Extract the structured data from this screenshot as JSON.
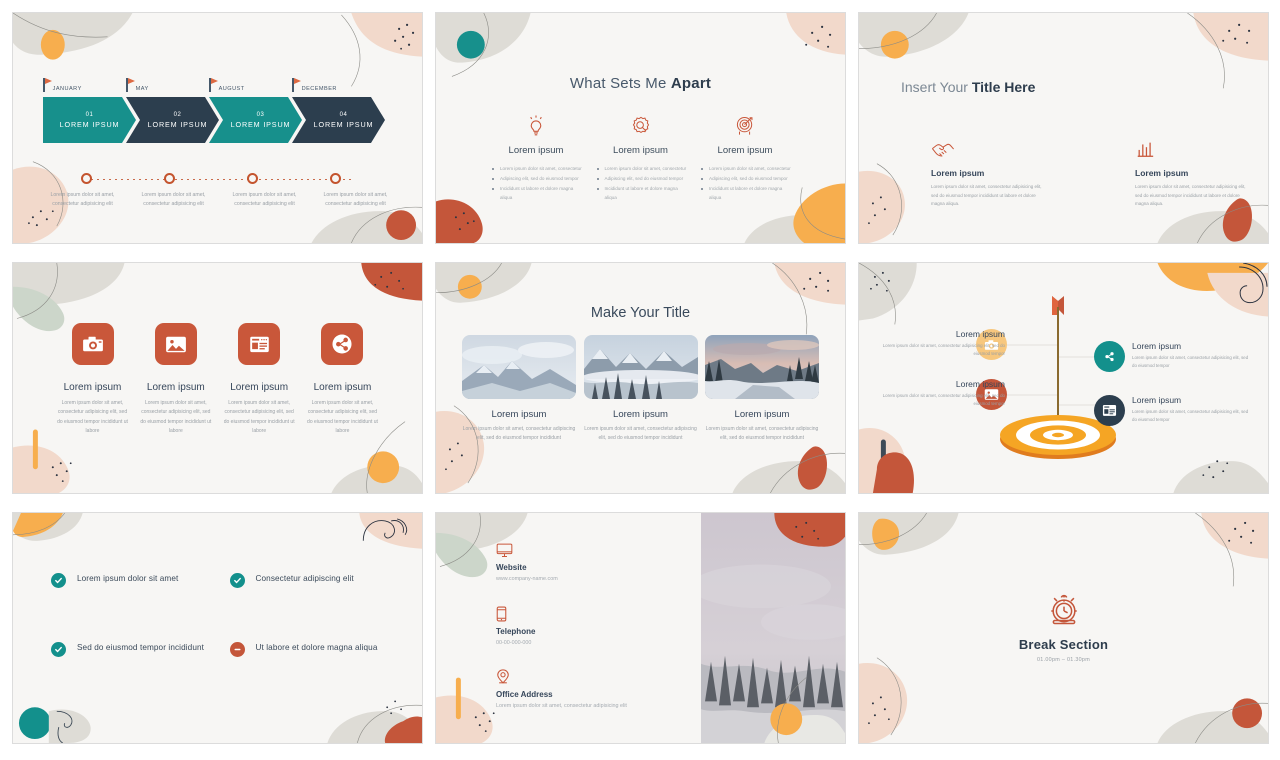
{
  "theme": {
    "teal": "#17908c",
    "navy": "#2c3e4e",
    "terracotta": "#c9573a",
    "orange": "#f5a93f",
    "blush": "#f2d9cb",
    "grey": "#dcdcd6",
    "slide_bg": "#f7f6f4"
  },
  "slides": [
    {
      "id": "timeline",
      "flags": [
        "JANUARY",
        "MAY",
        "AUGUST",
        "DECEMBER"
      ],
      "steps": [
        {
          "num": "01",
          "label": "LOREM IPSUM",
          "color": "teal"
        },
        {
          "num": "02",
          "label": "LOREM IPSUM",
          "color": "navy"
        },
        {
          "num": "03",
          "label": "LOREM IPSUM",
          "color": "teal"
        },
        {
          "num": "04",
          "label": "LOREM IPSUM",
          "color": "navy"
        }
      ],
      "captions": [
        "Lorem ipsum dolor sit amet, consectetur adipisicing elit",
        "Lorem ipsum dolor sit amet, consectetur adipisicing elit",
        "Lorem ipsum dolor sit amet, consectetur adipisicing elit",
        "Lorem ipsum dolor sit amet, consectetur adipisicing elit"
      ]
    },
    {
      "id": "what-sets-me-apart",
      "title_light": "What Sets Me ",
      "title_bold": "Apart",
      "columns": [
        {
          "icon": "lightbulb-icon",
          "heading": "Lorem ipsum",
          "bullets": [
            "Lorem ipsum dolor sit amet, consectetur",
            "Adipiscing elit, sed do eiusmod tempor",
            "Incididunt ut labore et dolore magna aliqua"
          ]
        },
        {
          "icon": "medal-icon",
          "heading": "Lorem ipsum",
          "bullets": [
            "Lorem ipsum dolor sit amet, consectetur",
            "Adipiscing elit, sed do eiusmod tempor",
            "Incididunt ut labore et dolore magna aliqua"
          ]
        },
        {
          "icon": "target-icon",
          "heading": "Lorem ipsum",
          "bullets": [
            "Lorem ipsum dolor sit amet, consectetur",
            "Adipiscing elit, sed do eiusmod tempor",
            "Incididunt ut labore et dolore magna aliqua"
          ]
        }
      ]
    },
    {
      "id": "insert-your-title-here",
      "title_light": "Insert Your ",
      "title_bold": "Title Here",
      "columns": [
        {
          "icon": "handshake-icon",
          "heading": "Lorem ipsum",
          "body": "Lorem ipsum dolor sit amet, consectetur adipisicing elit, sed do eiusmod tempor incididunt ut labore et dolore magna aliqua."
        },
        {
          "icon": "bar-chart-icon",
          "heading": "Lorem ipsum",
          "body": "Lorem ipsum dolor sit amet, consectetur adipisicing elit, sed do eiusmod tempor incididunt ut labore et dolore magna aliqua."
        }
      ]
    },
    {
      "id": "four-features",
      "columns": [
        {
          "icon": "camera-icon",
          "heading": "Lorem ipsum",
          "body": "Lorem ipsum dolor sit amet, consectetur adipisicing elit, sed do eiusmod tempor incididunt ut labore"
        },
        {
          "icon": "image-icon",
          "heading": "Lorem ipsum",
          "body": "Lorem ipsum dolor sit amet, consectetur adipisicing elit, sed do eiusmod tempor incididunt ut labore"
        },
        {
          "icon": "news-icon",
          "heading": "Lorem ipsum",
          "body": "Lorem ipsum dolor sit amet, consectetur adipisicing elit, sed do eiusmod tempor incididunt ut labore"
        },
        {
          "icon": "share-icon",
          "heading": "Lorem ipsum",
          "body": "Lorem ipsum dolor sit amet, consectetur adipisicing elit, sed do eiusmod tempor incididunt ut labore"
        }
      ]
    },
    {
      "id": "make-your-title",
      "title": "Make Your Title",
      "cards": [
        {
          "photo": "snowy-mountain-photo",
          "heading": "Lorem ipsum",
          "body": "Lorem ipsum dolor sit amet, consectetur adipiscing elit, sed do eiusmod tempor incididunt"
        },
        {
          "photo": "mountain-forest-photo",
          "heading": "Lorem ipsum",
          "body": "Lorem ipsum dolor sit amet, consectetur adipiscing elit, sed do eiusmod tempor incididunt"
        },
        {
          "photo": "winter-river-photo",
          "heading": "Lorem ipsum",
          "body": "Lorem ipsum dolor sit amet, consectetur adipiscing elit, sed do eiusmod tempor incididunt"
        }
      ]
    },
    {
      "id": "target-infographic",
      "items": [
        {
          "icon": "camera-icon",
          "side": "left",
          "heading": "Lorem ipsum",
          "body": "Lorem ipsum dolor sit amet, consectetur adipisicing elit, sed do eiusmod tempor",
          "color": "#f7b96a"
        },
        {
          "icon": "image-icon",
          "side": "left",
          "heading": "Lorem ipsum",
          "body": "Lorem ipsum dolor sit amet, consectetur adipisicing elit, sed do eiusmod tempor",
          "color": "#c4563a"
        },
        {
          "icon": "share-icon",
          "side": "right",
          "heading": "Lorem ipsum",
          "body": "Lorem ipsum dolor sit amet, consectetur adipisicing elit, sed do eiusmod tempor",
          "color": "#13908c"
        },
        {
          "icon": "news-icon",
          "side": "right",
          "heading": "Lorem ipsum",
          "body": "Lorem ipsum dolor sit amet, consectetur adipisicing elit, sed do eiusmod tempor",
          "color": "#2c3e4e"
        }
      ]
    },
    {
      "id": "checklist",
      "items": [
        {
          "status": "check",
          "text": "Lorem ipsum dolor sit amet"
        },
        {
          "status": "check",
          "text": "Consectetur adipiscing elit"
        },
        {
          "status": "check",
          "text": "Sed do eiusmod tempor incididunt"
        },
        {
          "status": "minus",
          "text": "Ut labore et dolore magna aliqua"
        }
      ]
    },
    {
      "id": "contact",
      "items": [
        {
          "icon": "monitor-icon",
          "label": "Website",
          "value": "www.company-name.com"
        },
        {
          "icon": "phone-icon",
          "label": "Telephone",
          "value": "00-00-000-000"
        },
        {
          "icon": "location-pin-icon",
          "label": "Office Address",
          "value": "Lorem ipsum dolor sit amet, consectetur adipisicing elit"
        }
      ],
      "photo": "winter-forest-photo"
    },
    {
      "id": "break-section",
      "icon": "alarm-clock-icon",
      "title": "Break Section",
      "time": "01.00pm – 01.30pm"
    }
  ]
}
